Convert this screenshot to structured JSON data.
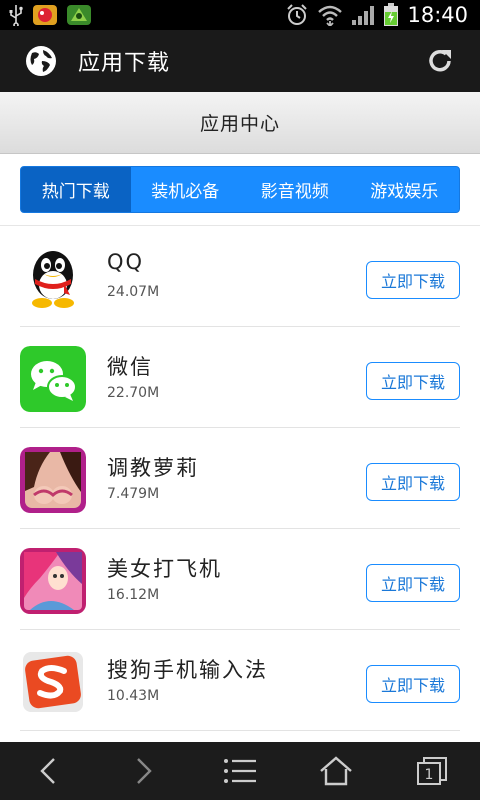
{
  "status_bar": {
    "time": "18:40",
    "icons": [
      "usb-icon",
      "app-notification-icon-1",
      "app-notification-icon-2",
      "alarm-icon",
      "wifi-icon",
      "signal-icon",
      "battery-charging-icon"
    ]
  },
  "title_bar": {
    "title": "应用下载",
    "left_icon": "globe-icon",
    "right_icon": "refresh-icon"
  },
  "section": {
    "title": "应用中心"
  },
  "tabs": [
    {
      "label": "热门下载",
      "active": true
    },
    {
      "label": "装机必备",
      "active": false
    },
    {
      "label": "影音视频",
      "active": false
    },
    {
      "label": "游戏娱乐",
      "active": false
    }
  ],
  "apps": [
    {
      "name": "QQ",
      "size": "24.07M",
      "icon": "qq-penguin-icon",
      "button": "立即下载"
    },
    {
      "name": "微信",
      "size": "22.70M",
      "icon": "wechat-icon",
      "button": "立即下载"
    },
    {
      "name": "调教萝莉",
      "size": "7.479M",
      "icon": "game-girl-icon",
      "button": "立即下载"
    },
    {
      "name": "美女打飞机",
      "size": "16.12M",
      "icon": "anime-game-icon",
      "button": "立即下载"
    },
    {
      "name": "搜狗手机输入法",
      "size": "10.43M",
      "icon": "sogou-input-icon",
      "button": "立即下载"
    }
  ],
  "nav_bar": {
    "items": [
      "back-icon",
      "forward-icon",
      "menu-icon",
      "home-icon",
      "tabs-icon"
    ],
    "tab_count": "1"
  },
  "colors": {
    "tab_bar": "#1a8cff",
    "tab_active": "#0a63c4",
    "button_border": "#1a8cff",
    "title_bar": "#1a1a1a"
  }
}
